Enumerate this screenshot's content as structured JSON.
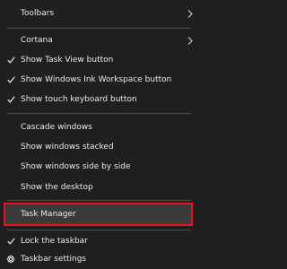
{
  "menu": {
    "items": {
      "toolbars": "Toolbars",
      "cortana": "Cortana",
      "task_view": "Show Task View button",
      "ink_workspace": "Show Windows Ink Workspace button",
      "touch_keyboard": "Show touch keyboard button",
      "cascade": "Cascade windows",
      "stacked": "Show windows stacked",
      "side_by_side": "Show windows side by side",
      "desktop": "Show the desktop",
      "task_manager": "Task Manager",
      "lock_taskbar": "Lock the taskbar",
      "taskbar_settings": "Taskbar settings"
    },
    "checked": [
      "task_view",
      "ink_workspace",
      "touch_keyboard",
      "lock_taskbar"
    ],
    "submenu_items": [
      "toolbars",
      "cortana"
    ],
    "highlighted": "task_manager",
    "highlight_border_color": "#e81123",
    "icons": {
      "check": "check-icon",
      "submenu": "chevron-right-icon",
      "settings": "gear-icon"
    }
  }
}
